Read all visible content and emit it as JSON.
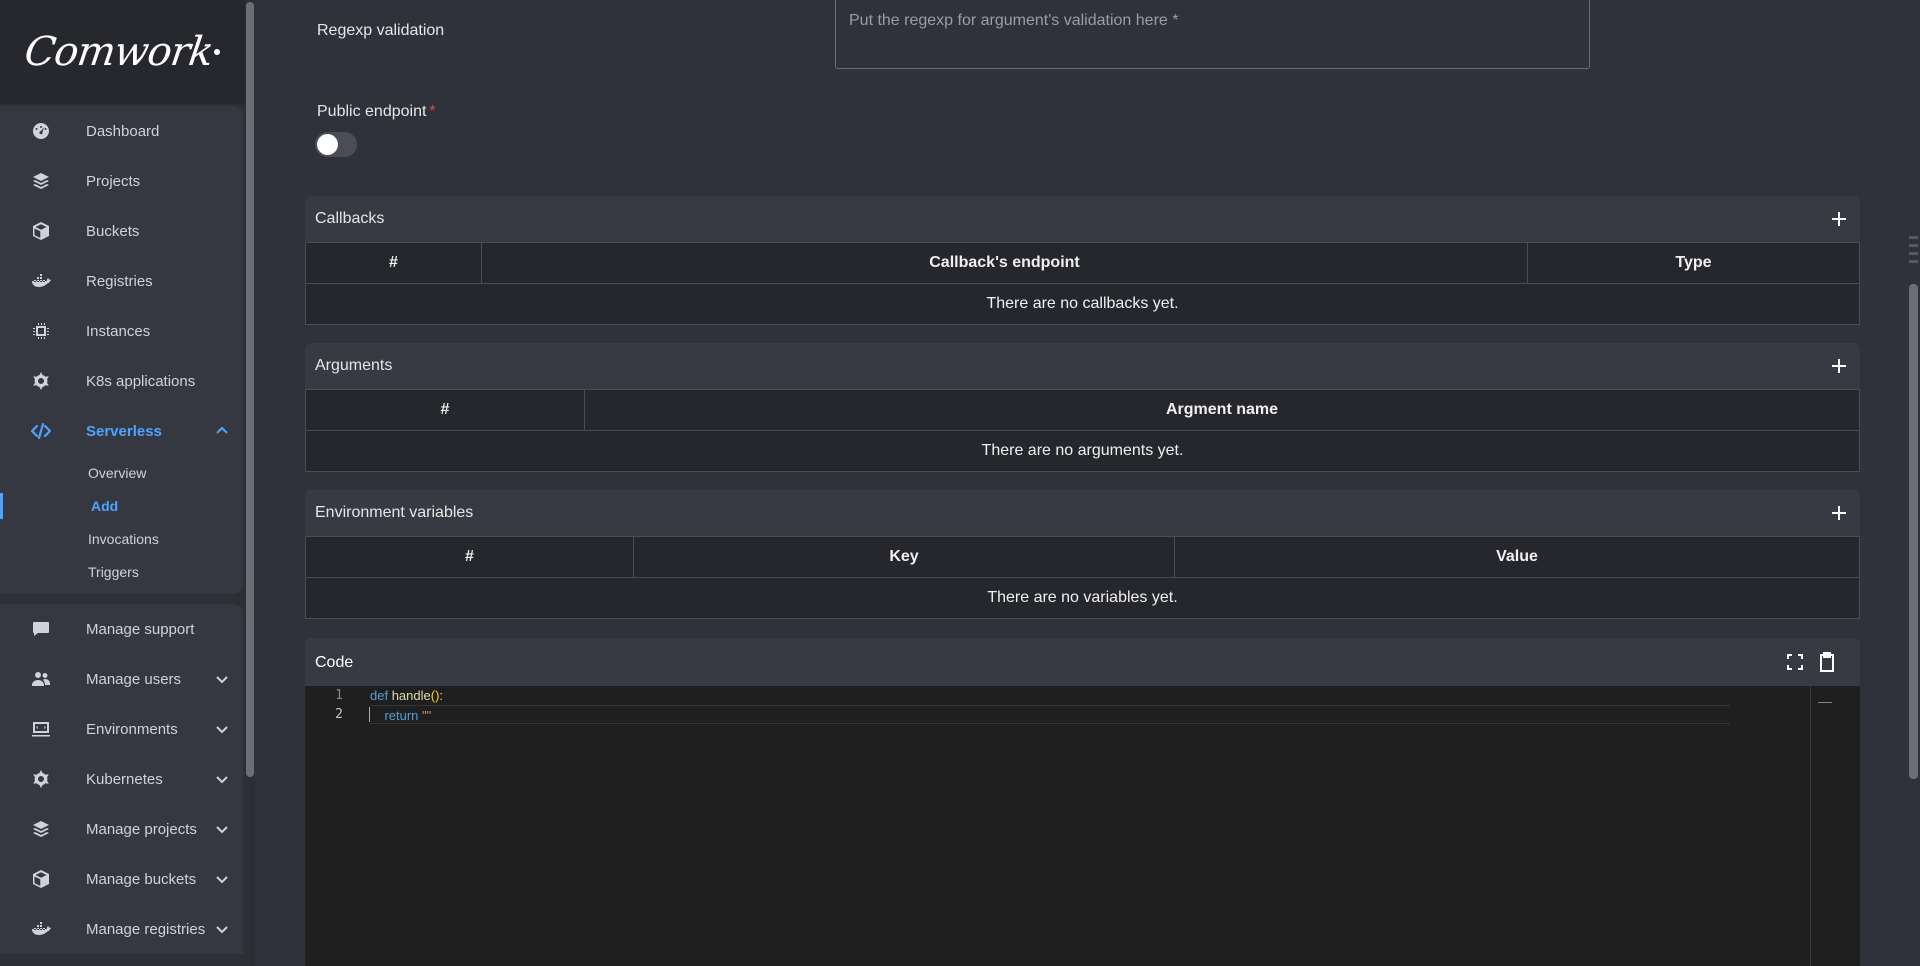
{
  "logo": {
    "text": "Comwork"
  },
  "sidebar": {
    "items": [
      {
        "label": "Dashboard",
        "icon": "dashboard-icon"
      },
      {
        "label": "Projects",
        "icon": "layers-icon"
      },
      {
        "label": "Buckets",
        "icon": "cube-icon"
      },
      {
        "label": "Registries",
        "icon": "docker-icon"
      },
      {
        "label": "Instances",
        "icon": "chip-icon"
      },
      {
        "label": "K8s applications",
        "icon": "helm-icon"
      },
      {
        "label": "Serverless",
        "icon": "code-icon",
        "active": true,
        "expanded": true
      }
    ],
    "serverless_sub": [
      {
        "label": "Overview"
      },
      {
        "label": "Add",
        "active": true
      },
      {
        "label": "Invocations"
      },
      {
        "label": "Triggers"
      }
    ],
    "admin_items": [
      {
        "label": "Manage support",
        "icon": "chat-icon"
      },
      {
        "label": "Manage users",
        "icon": "users-icon"
      },
      {
        "label": "Environments",
        "icon": "monitor-icon"
      },
      {
        "label": "Kubernetes",
        "icon": "helm-icon"
      },
      {
        "label": "Manage projects",
        "icon": "layers-icon"
      },
      {
        "label": "Manage buckets",
        "icon": "cube-icon"
      },
      {
        "label": "Manage registries",
        "icon": "docker-icon"
      }
    ]
  },
  "form": {
    "regexp_label": "Regexp validation",
    "regexp_placeholder": "Put the regexp for argument's validation here *",
    "public_endpoint_label": "Public endpoint",
    "required_mark": "*",
    "public_endpoint_value": false
  },
  "callbacks": {
    "title": "Callbacks",
    "columns": [
      "#",
      "Callback's endpoint",
      "Type"
    ],
    "empty": "There are no callbacks yet."
  },
  "arguments": {
    "title": "Arguments",
    "columns": [
      "#",
      "Argment name"
    ],
    "empty": "There are no arguments yet."
  },
  "env_vars": {
    "title": "Environment variables",
    "columns": [
      "#",
      "Key",
      "Value"
    ],
    "empty": "There are no variables yet."
  },
  "code": {
    "title": "Code",
    "line_numbers": [
      "1",
      "2"
    ],
    "lines": {
      "l1_kw": "def",
      "l1_fn": "handle",
      "l1_par": "()",
      "l1_colon": ":",
      "l2_kw": "return",
      "l2_str": "\"\""
    }
  },
  "colors": {
    "accent": "#4da3ff",
    "background": "#2f323a",
    "sidebar": "#2c2f36",
    "required": "#e04848",
    "editor_bg": "#1f1f1f"
  }
}
